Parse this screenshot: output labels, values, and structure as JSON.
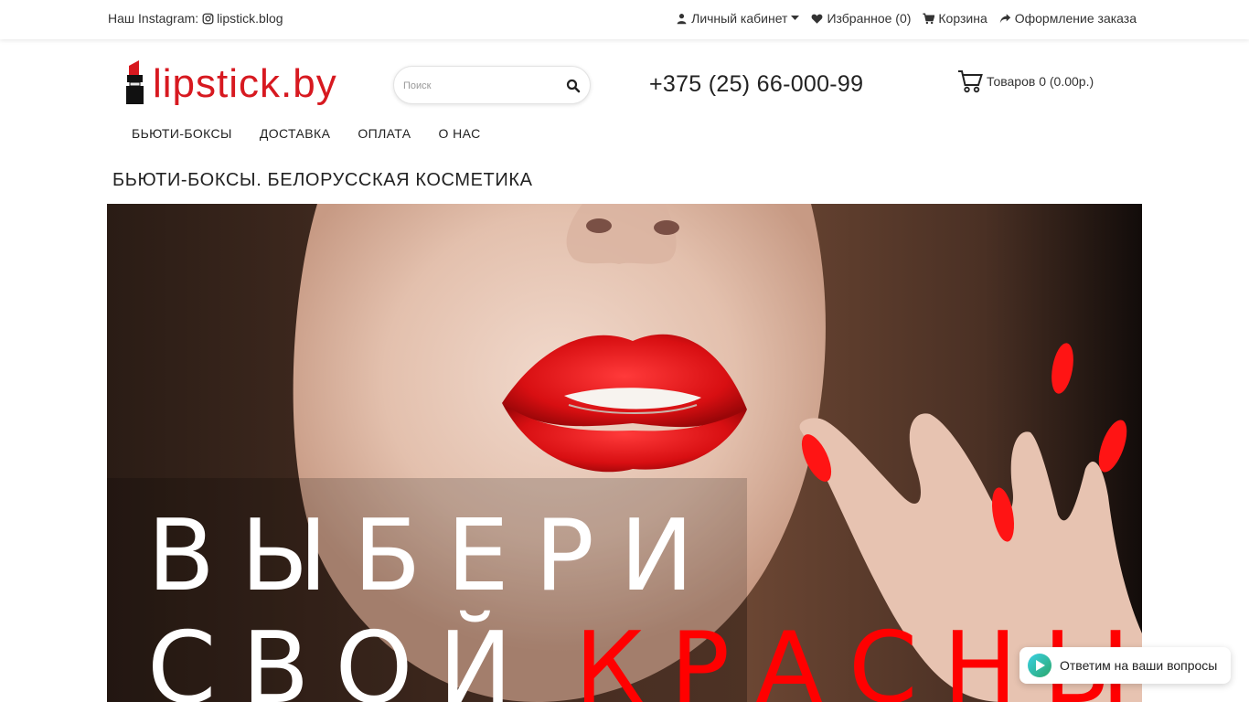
{
  "topbar": {
    "instagram_label": "Наш Instagram:",
    "instagram_handle": "lipstick.blog",
    "nav": {
      "account": "Личный кабинет",
      "favorites": "Избранное (0)",
      "cart": "Корзина",
      "checkout": "Оформление заказа"
    }
  },
  "header": {
    "logo_text": "lipstick.by",
    "search_placeholder": "Поиск",
    "phone": "+375 (25) 66-000-99",
    "cart_summary": "Товаров 0 (0.00р.)"
  },
  "main_nav": [
    "БЬЮТИ-БОКСЫ",
    "ДОСТАВКА",
    "ОПЛАТА",
    "О НАС"
  ],
  "page_title": "БЬЮТИ-БОКСЫ. БЕЛОРУССКАЯ КОСМЕТИКА",
  "banner": {
    "line1": "ВЫБЕРИ",
    "line2_white": "СВОЙ",
    "line2_red": "КРАСНЫЙ"
  },
  "chat_widget": {
    "label": "Ответим на ваши вопросы"
  },
  "colors": {
    "brand_red": "#d71920",
    "headline_red": "#ff0000"
  },
  "icons": [
    "instagram-icon",
    "user-icon",
    "caret-down-icon",
    "heart-icon",
    "shopping-cart-icon",
    "share-icon",
    "search-icon",
    "cart-outline-icon",
    "lipstick-icon",
    "chat-bubble-icon"
  ]
}
